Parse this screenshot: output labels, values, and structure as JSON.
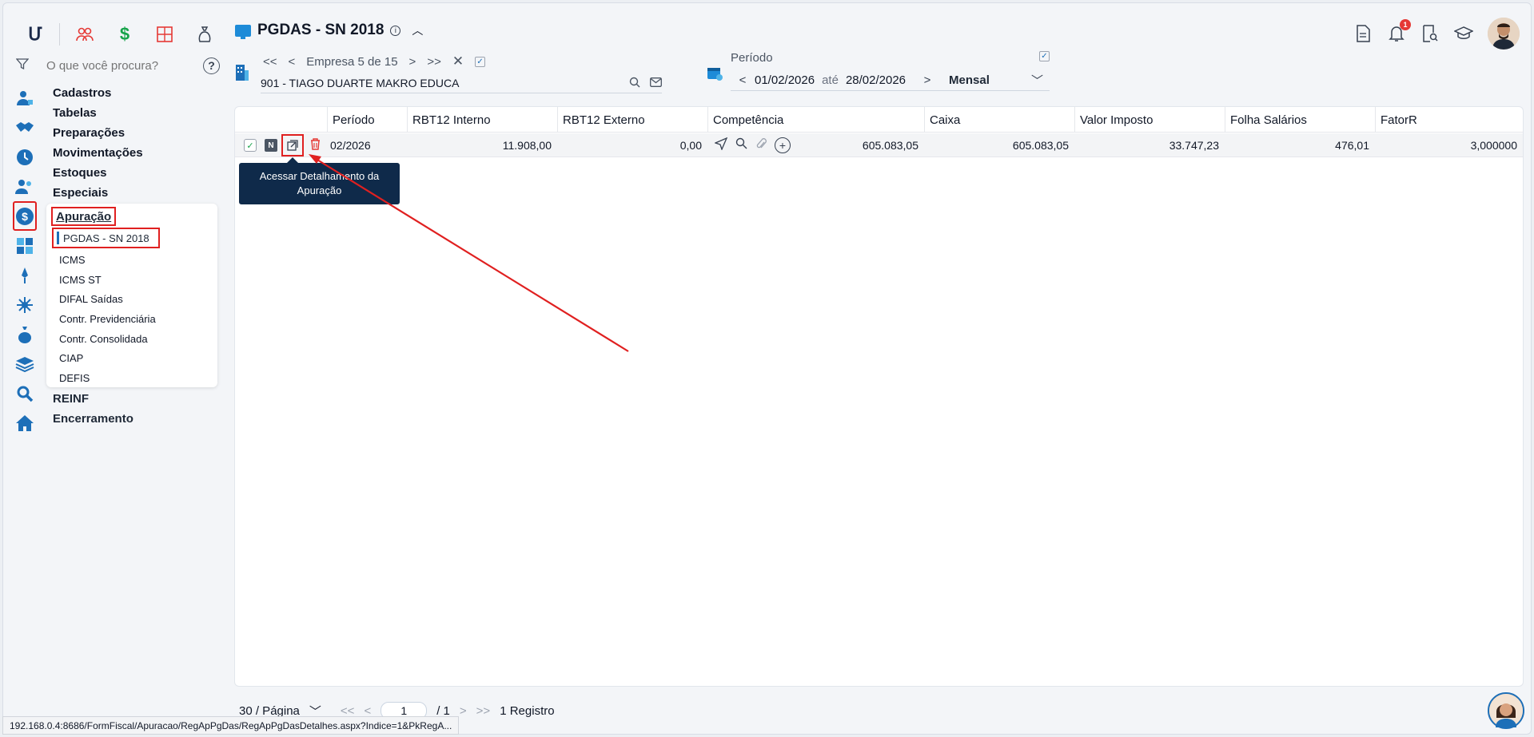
{
  "topnav": {
    "icons": [
      "logo",
      "people-icon",
      "dollar-icon",
      "calculator-icon",
      "money-bag-icon"
    ],
    "logo_text": "Մ"
  },
  "search": {
    "placeholder": "O que você procura?"
  },
  "menu": {
    "items": [
      "Cadastros",
      "Tabelas",
      "Preparações",
      "Movimentações",
      "Estoques",
      "Especiais"
    ],
    "submenu_title": "Apuração",
    "submenu_active": "PGDAS - SN 2018",
    "submenu_items": [
      "ICMS",
      "ICMS ST",
      "DIFAL Saídas",
      "Contr. Previdenciária",
      "Contr. Consolidada",
      "CIAP",
      "DEFIS"
    ],
    "items_after": [
      "REINF",
      "Encerramento"
    ]
  },
  "header": {
    "title": "PGDAS - SN 2018",
    "notification_count": "1"
  },
  "empresa": {
    "counter": "Empresa 5 de 15",
    "value": "901 - TIAGO DUARTE MAKRO EDUCA"
  },
  "periodo": {
    "label": "Período",
    "start": "01/02/2026",
    "between": "até",
    "end": "28/02/2026",
    "frequency": "Mensal"
  },
  "table": {
    "headers": [
      "Período",
      "RBT12 Interno",
      "RBT12 Externo",
      "Competência",
      "Caixa",
      "Valor Imposto",
      "Folha Salários",
      "FatorR"
    ],
    "row": {
      "badge": "N",
      "periodo": "02/2026",
      "rbt12_interno": "11.908,00",
      "rbt12_externo": "0,00",
      "competencia": "605.083,05",
      "caixa": "605.083,05",
      "valor_imposto": "33.747,23",
      "folha_salarios": "476,01",
      "fatorr": "3,000000"
    },
    "tooltip": "Acessar Detalhamento da Apuração"
  },
  "pager": {
    "per_page": "30 / Página",
    "page": "1",
    "total_pages": "/ 1",
    "records": "1 Registro"
  },
  "status_url": "192.168.0.4:8686/FormFiscal/Apuracao/RegApPgDas/RegApPgDasDetalhes.aspx?Indice=1&PkRegA...",
  "colors": {
    "accent": "#1d6fb8",
    "highlight": "#e02020",
    "tooltip_bg": "#0f2a4a"
  }
}
